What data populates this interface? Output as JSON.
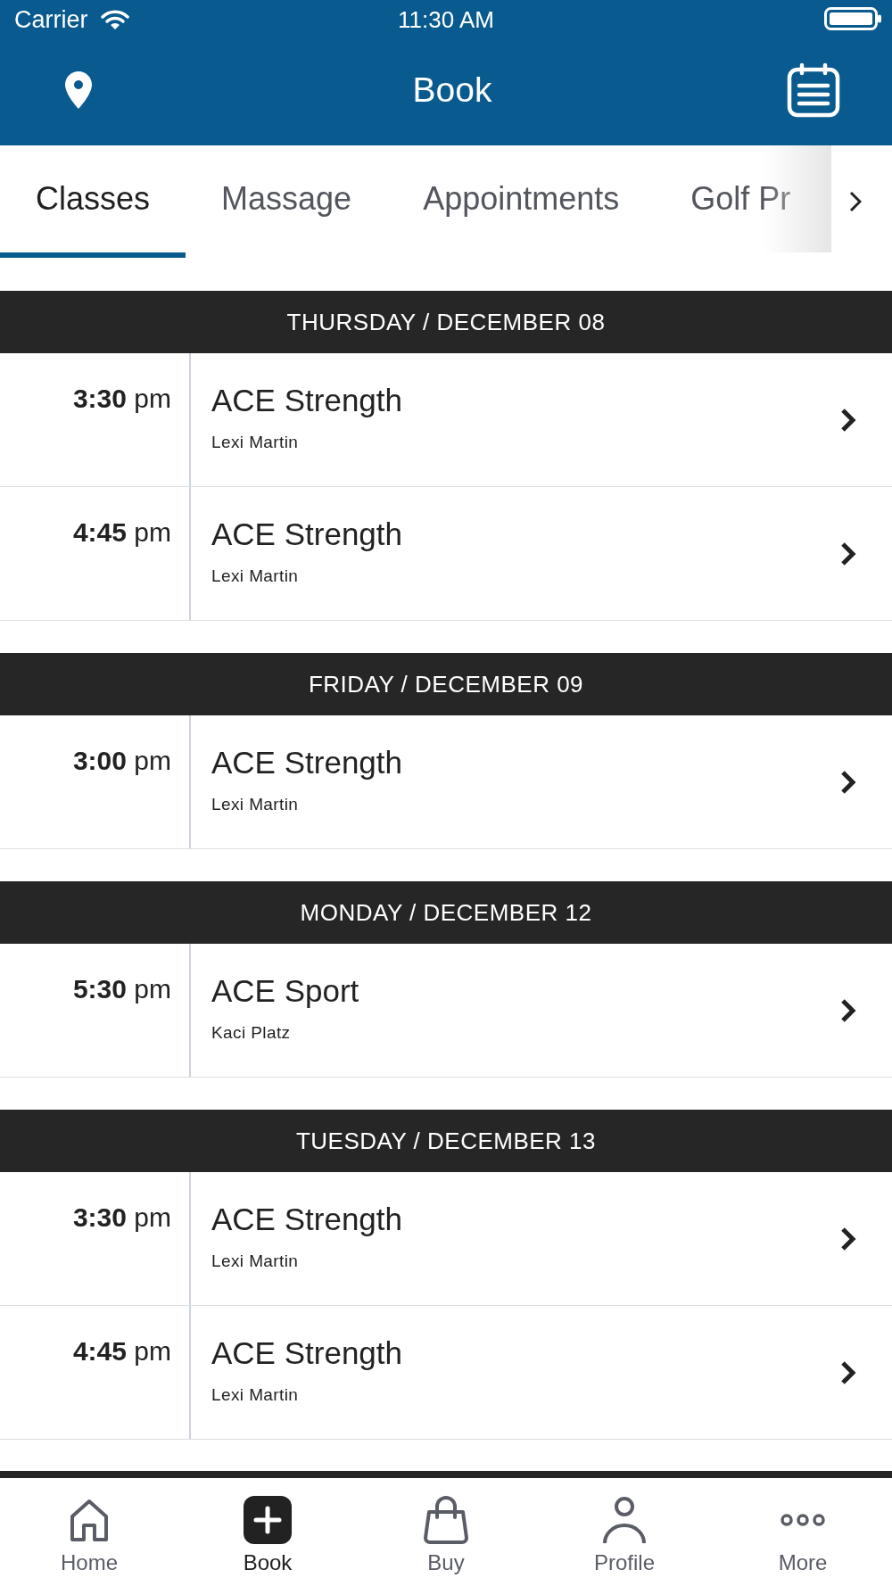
{
  "status_bar": {
    "carrier": "Carrier",
    "time": "11:30 AM"
  },
  "header": {
    "title": "Book"
  },
  "tabs": [
    {
      "label": "Classes",
      "selected": true
    },
    {
      "label": "Massage",
      "selected": false
    },
    {
      "label": "Appointments",
      "selected": false
    },
    {
      "label": "Golf Pr",
      "selected": false
    }
  ],
  "days": [
    {
      "heading": "THURSDAY / DECEMBER 08",
      "classes": [
        {
          "hour": "3:30",
          "period": "pm",
          "name": "ACE Strength",
          "instructor": "Lexi Martin"
        },
        {
          "hour": "4:45",
          "period": "pm",
          "name": "ACE Strength",
          "instructor": "Lexi Martin"
        }
      ]
    },
    {
      "heading": "FRIDAY / DECEMBER 09",
      "classes": [
        {
          "hour": "3:00",
          "period": "pm",
          "name": "ACE Strength",
          "instructor": "Lexi Martin"
        }
      ]
    },
    {
      "heading": "MONDAY / DECEMBER 12",
      "classes": [
        {
          "hour": "5:30",
          "period": "pm",
          "name": "ACE Sport",
          "instructor": "Kaci Platz"
        }
      ]
    },
    {
      "heading": "TUESDAY / DECEMBER 13",
      "classes": [
        {
          "hour": "3:30",
          "period": "pm",
          "name": "ACE Strength",
          "instructor": "Lexi Martin"
        },
        {
          "hour": "4:45",
          "period": "pm",
          "name": "ACE Strength",
          "instructor": "Lexi Martin"
        }
      ]
    }
  ],
  "tab_bar": [
    {
      "kind": "home",
      "label": "Home",
      "selected": false
    },
    {
      "kind": "book",
      "label": "Book",
      "selected": true
    },
    {
      "kind": "buy",
      "label": "Buy",
      "selected": false
    },
    {
      "kind": "profile",
      "label": "Profile",
      "selected": false
    },
    {
      "kind": "more",
      "label": "More",
      "selected": false
    }
  ]
}
